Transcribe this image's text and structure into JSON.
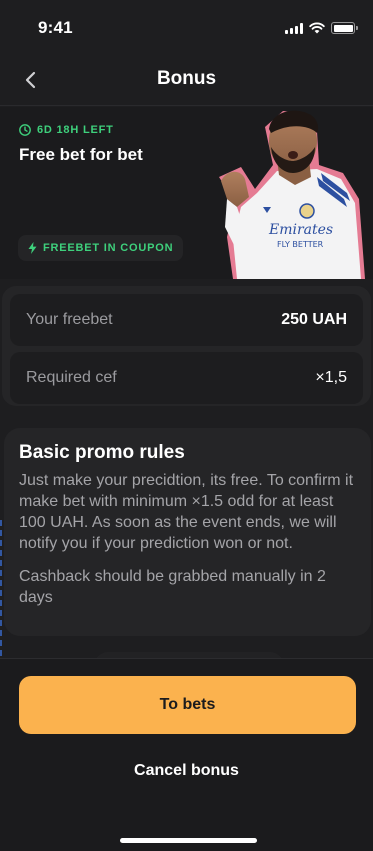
{
  "status_bar": {
    "time": "9:41"
  },
  "nav": {
    "title": "Bonus",
    "back_icon": "chevron-left-icon"
  },
  "bonus": {
    "timer": "6D 18H LEFT",
    "title": "Free bet for bet",
    "chip": "FREEBET IN COUPON",
    "colors": {
      "accent_green": "#3ed07c",
      "accent_orange": "#fbb24e"
    }
  },
  "details": {
    "freebet_label": "Your freebet",
    "freebet_value": "250 UAH",
    "cef_label": "Required cef",
    "cef_value": "×1,5"
  },
  "rules": {
    "title": "Basic promo rules",
    "paragraph1": "Just make your precidtion, its free. To confirm it make bet with minimum ×1.5 odd for at least 100 UAH. As soon as the event ends, we will notify you if your prediction won or not.",
    "paragraph2": "Cashback should be grabbed manually in 2 days"
  },
  "actions": {
    "primary": "To bets",
    "secondary": "Cancel bonus"
  }
}
